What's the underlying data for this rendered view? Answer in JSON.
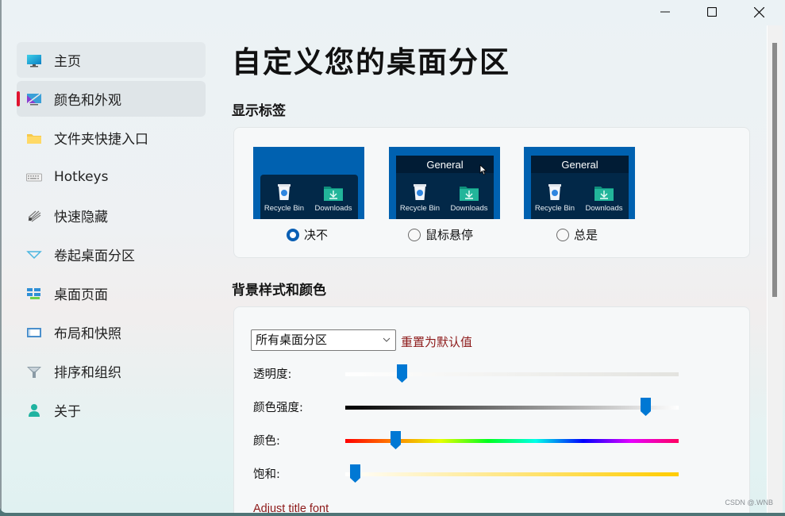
{
  "window": {
    "minimize_icon": "minimize-icon",
    "maximize_icon": "maximize-icon",
    "close_icon": "close-icon"
  },
  "sidebar": {
    "items": [
      {
        "label": "主页",
        "icon": "monitor-icon",
        "state": "hover"
      },
      {
        "label": "颜色和外观",
        "icon": "color-appearance-icon",
        "state": "selected"
      },
      {
        "label": "文件夹快捷入口",
        "icon": "folder-icon",
        "state": ""
      },
      {
        "label": "Hotkeys",
        "icon": "keyboard-icon",
        "state": ""
      },
      {
        "label": "快速隐藏",
        "icon": "quick-hide-icon",
        "state": ""
      },
      {
        "label": "卷起桌面分区",
        "icon": "roll-up-triangle-icon",
        "state": ""
      },
      {
        "label": "桌面页面",
        "icon": "desktop-pages-icon",
        "state": ""
      },
      {
        "label": "布局和快照",
        "icon": "layout-icon",
        "state": ""
      },
      {
        "label": "排序和组织",
        "icon": "funnel-icon",
        "state": ""
      },
      {
        "label": "关于",
        "icon": "person-icon",
        "state": ""
      }
    ],
    "selected_indicator_color": "#e0142f"
  },
  "main": {
    "title": "自定义您的桌面分区",
    "show_labels": {
      "heading": "显示标签",
      "options": [
        {
          "label": "决不",
          "checked": true,
          "preview_title": "",
          "icons": [
            "Recycle Bin",
            "Downloads"
          ]
        },
        {
          "label": "鼠标悬停",
          "checked": false,
          "preview_title": "General",
          "icons": [
            "Recycle Bin",
            "Downloads"
          ]
        },
        {
          "label": "总是",
          "checked": false,
          "preview_title": "General",
          "icons": [
            "Recycle Bin",
            "Downloads"
          ]
        }
      ]
    },
    "background": {
      "heading": "背景样式和颜色",
      "scope_select": {
        "value": "所有桌面分区"
      },
      "reset_link": "重置为默认值",
      "sliders": [
        {
          "label": "透明度:",
          "value_fraction": 0.17,
          "gradient": [
            "#ffffff",
            "#e3e3df"
          ]
        },
        {
          "label": "颜色强度:",
          "value_fraction": 0.9,
          "gradient": [
            "#000000",
            "#ffffff"
          ]
        },
        {
          "label": "颜色:",
          "value_fraction": 0.15,
          "gradient": [
            "#ff0000",
            "#ff8000",
            "#e6ff00",
            "#00ff20",
            "#00ffe8",
            "#0000ff",
            "#e600ff",
            "#ff0060"
          ]
        },
        {
          "label": "饱和:",
          "value_fraction": 0.03,
          "gradient": [
            "#ffffff",
            "#ffcc00"
          ]
        }
      ],
      "adjust_title_font_link": "Adjust title font"
    },
    "accent_color": "#0078d4",
    "link_color": "#8d1a1a"
  },
  "watermark": "CSDN @.WNB"
}
